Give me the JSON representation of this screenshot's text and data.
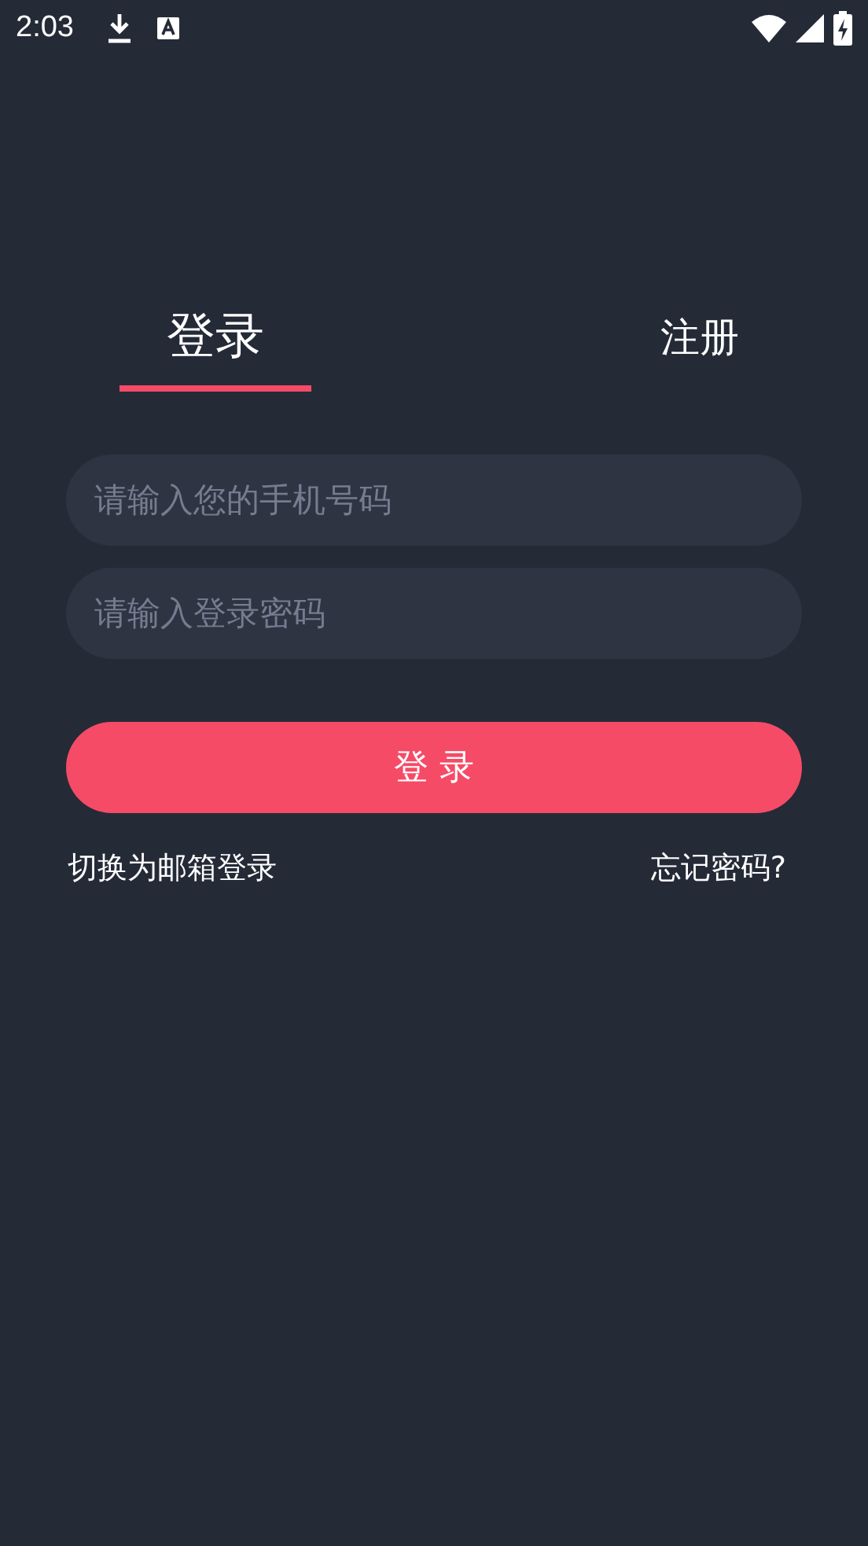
{
  "status_bar": {
    "time": "2:03"
  },
  "tabs": [
    {
      "label": "登录",
      "selected": true
    },
    {
      "label": "注册",
      "selected": false
    }
  ],
  "fields": [
    {
      "placeholder": "请输入您的手机号码"
    },
    {
      "placeholder": "请输入登录密码"
    }
  ],
  "login_button": "登 录",
  "links": {
    "switch": "切换为邮箱登录",
    "forgot": "忘记密码?"
  }
}
